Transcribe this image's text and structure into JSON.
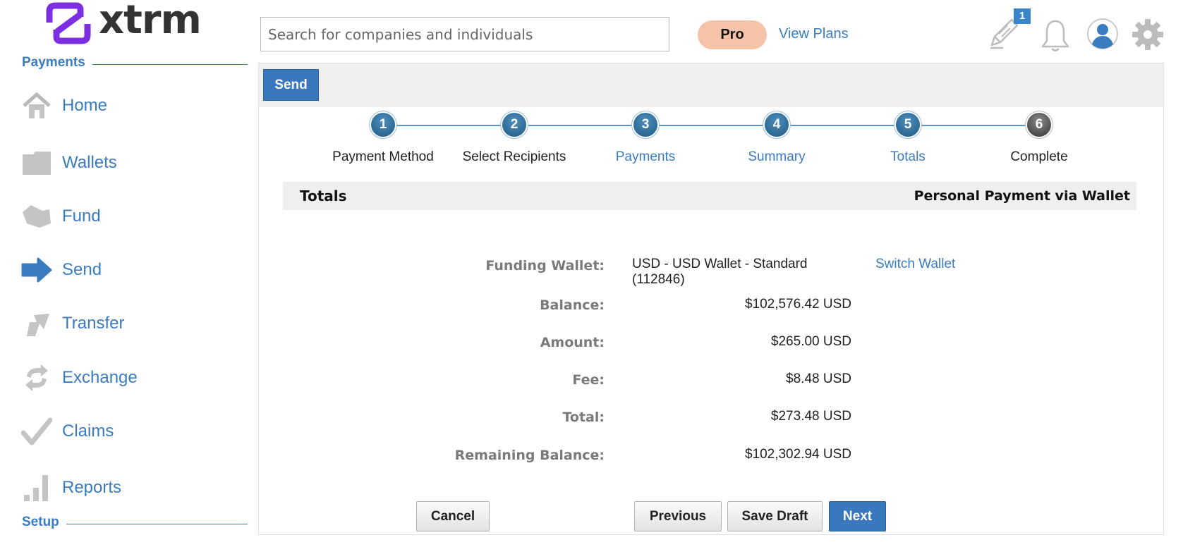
{
  "brand": {
    "name": "xtrm",
    "logo_color": "#7b2fe0"
  },
  "sidebar": {
    "payments_heading": "Payments",
    "setup_heading": "Setup",
    "items": [
      {
        "label": "Home",
        "icon": "home-icon"
      },
      {
        "label": "Wallets",
        "icon": "folder-icon"
      },
      {
        "label": "Fund",
        "icon": "fund-icon"
      },
      {
        "label": "Send",
        "icon": "send-arrow-icon",
        "active": true
      },
      {
        "label": "Transfer",
        "icon": "transfer-icon"
      },
      {
        "label": "Exchange",
        "icon": "exchange-icon"
      },
      {
        "label": "Claims",
        "icon": "checkmark-icon"
      },
      {
        "label": "Reports",
        "icon": "bar-chart-icon"
      }
    ]
  },
  "header": {
    "search_placeholder": "Search for companies and individuals",
    "plan_badge": "Pro",
    "view_plans": "View Plans",
    "notification_count": "1"
  },
  "main": {
    "tab_label": "Send",
    "steps": [
      {
        "number": "1",
        "label": "Payment Method",
        "style": "dark"
      },
      {
        "number": "2",
        "label": "Select Recipients",
        "style": "dark"
      },
      {
        "number": "3",
        "label": "Payments",
        "style": "link"
      },
      {
        "number": "4",
        "label": "Summary",
        "style": "link"
      },
      {
        "number": "5",
        "label": "Totals",
        "style": "link"
      },
      {
        "number": "6",
        "label": "Complete",
        "style": "dark"
      }
    ],
    "section_title": "Totals",
    "section_subtitle": "Personal Payment via Wallet",
    "details": {
      "funding_wallet_label": "Funding Wallet:",
      "funding_wallet_line1": "USD - USD Wallet - Standard",
      "funding_wallet_line2": "(112846)",
      "switch_wallet": "Switch Wallet",
      "balance_label": "Balance:",
      "balance_value": "$102,576.42 USD",
      "amount_label": "Amount:",
      "amount_value": "$265.00 USD",
      "fee_label": "Fee:",
      "fee_value": "$8.48 USD",
      "total_label": "Total:",
      "total_value": "$273.48 USD",
      "remaining_label": "Remaining Balance:",
      "remaining_value": "$102,302.94 USD"
    },
    "buttons": {
      "cancel": "Cancel",
      "previous": "Previous",
      "save_draft": "Save Draft",
      "next": "Next"
    }
  },
  "colors": {
    "accent": "#3a7cc0",
    "button_primary": "#3a78bd",
    "pro_badge": "#f4c3a8",
    "panel_bg": "#efefef"
  }
}
